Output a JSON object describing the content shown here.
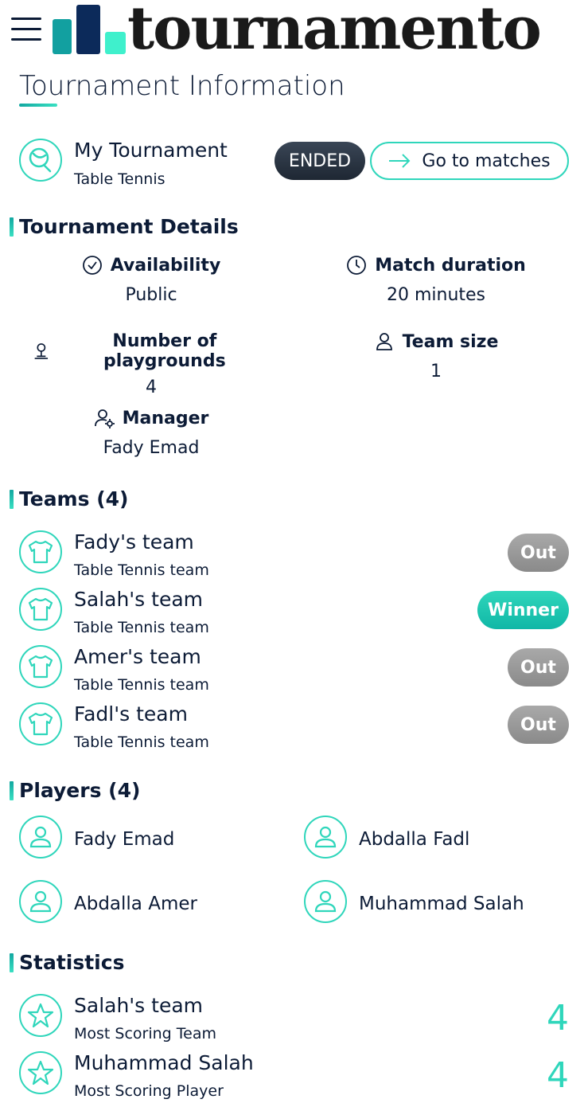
{
  "header": {
    "brand": "tournamento",
    "page_title": "Tournament Information"
  },
  "tournament": {
    "name": "My Tournament",
    "sport": "Table Tennis",
    "status": "ENDED",
    "go_button": "Go to matches"
  },
  "details": {
    "heading": "Tournament Details",
    "availability_label": "Availability",
    "availability_value": "Public",
    "duration_label": "Match duration",
    "duration_value": "20 minutes",
    "playgrounds_label": "Number of playgrounds",
    "playgrounds_value": "4",
    "team_size_label": "Team size",
    "team_size_value": "1",
    "manager_label": "Manager",
    "manager_value": "Fady Emad"
  },
  "teams": {
    "heading": "Teams (4)",
    "items": [
      {
        "name": "Fady's team",
        "sub": "Table Tennis team",
        "status": "Out"
      },
      {
        "name": "Salah's team",
        "sub": "Table Tennis team",
        "status": "Winner"
      },
      {
        "name": "Amer's team",
        "sub": "Table Tennis team",
        "status": "Out"
      },
      {
        "name": "Fadl's team",
        "sub": "Table Tennis team",
        "status": "Out"
      }
    ]
  },
  "players": {
    "heading": "Players (4)",
    "items": [
      {
        "name": "Fady Emad"
      },
      {
        "name": "Abdalla Fadl"
      },
      {
        "name": "Abdalla Amer"
      },
      {
        "name": "Muhammad Salah"
      }
    ]
  },
  "statistics": {
    "heading": "Statistics",
    "items": [
      {
        "name": "Salah's team",
        "sub": "Most Scoring Team",
        "value": "4"
      },
      {
        "name": "Muhammad Salah",
        "sub": "Most Scoring Player",
        "value": "4"
      }
    ]
  },
  "colors": {
    "accent": "#2fd6bb",
    "navy": "#0c1b36",
    "ended": "#2a3441",
    "out": "#9a9a9a"
  }
}
